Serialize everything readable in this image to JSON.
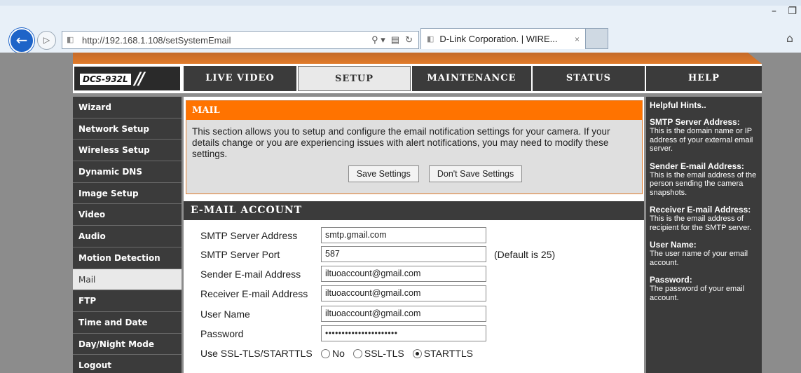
{
  "browser": {
    "url": "http://192.168.1.108/setSystemEmail",
    "tab_title": "D-Link Corporation. | WIRE...",
    "tab_close": "×",
    "search_glyph": "⚲ ▾",
    "compat_glyph": "▤",
    "refresh_glyph": "↻",
    "minimize": "–",
    "restore": "❐"
  },
  "header": {
    "logo_text": "DCS-932L",
    "logo_slashes": "//",
    "tabs": {
      "live_video": "LIVE VIDEO",
      "setup": "SETUP",
      "maintenance": "MAINTENANCE",
      "status": "STATUS",
      "help": "HELP"
    }
  },
  "sidebar": {
    "items": [
      {
        "label": "Wizard"
      },
      {
        "label": "Network Setup"
      },
      {
        "label": "Wireless Setup"
      },
      {
        "label": "Dynamic DNS"
      },
      {
        "label": "Image Setup"
      },
      {
        "label": "Video"
      },
      {
        "label": "Audio"
      },
      {
        "label": "Motion Detection"
      },
      {
        "label": "Mail"
      },
      {
        "label": "FTP"
      },
      {
        "label": "Time and Date"
      },
      {
        "label": "Day/Night Mode"
      },
      {
        "label": "Logout"
      }
    ],
    "active": "Mail"
  },
  "mail": {
    "title": "MAIL",
    "description": "This section allows you to setup and configure the email notification settings for your camera. If your details change or you are experiencing issues with alert notifications, you may need to modify these settings.",
    "save_label": "Save Settings",
    "dont_save_label": "Don't Save Settings"
  },
  "account": {
    "title": "E-MAIL ACCOUNT",
    "smtp_server_label": "SMTP Server Address",
    "smtp_server_value": "smtp.gmail.com",
    "smtp_port_label": "SMTP Server Port",
    "smtp_port_value": "587",
    "smtp_port_note": "(Default is 25)",
    "sender_label": "Sender E-mail Address",
    "sender_value": "iltuoaccount@gmail.com",
    "receiver_label": "Receiver E-mail Address",
    "receiver_value": "iltuoaccount@gmail.com",
    "username_label": "User Name",
    "username_value": "iltuoaccount@gmail.com",
    "password_label": "Password",
    "password_value": "••••••••••••••••••••••",
    "ssl_label": "Use SSL-TLS/STARTTLS",
    "ssl_options": [
      "No",
      "SSL-TLS",
      "STARTTLS"
    ],
    "ssl_selected": "STARTTLS"
  },
  "help": {
    "title": "Helpful Hints..",
    "items": [
      {
        "head": "SMTP Server Address:",
        "body": "This is the domain name or IP address of your external email server."
      },
      {
        "head": "Sender E-mail Address:",
        "body": "This is the email address of the person sending the camera snapshots."
      },
      {
        "head": "Receiver E-mail Address:",
        "body": "This is the email address of recipient for the SMTP server."
      },
      {
        "head": "User Name:",
        "body": "The user name of your email account."
      },
      {
        "head": "Password:",
        "body": "The password of your email account."
      }
    ]
  },
  "icons": {
    "back": "back-arrow-icon",
    "forward": "forward-arrow-icon",
    "home": "home-icon",
    "favicon": "page-favicon-icon"
  }
}
